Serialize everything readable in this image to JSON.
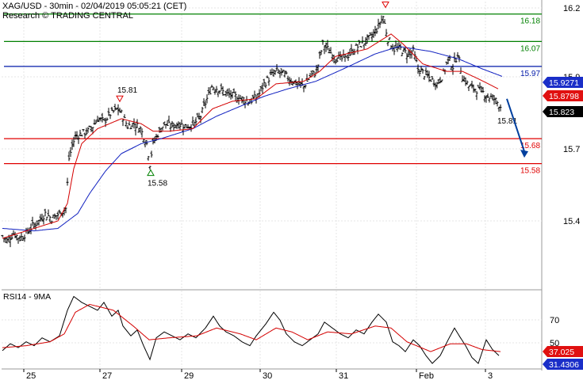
{
  "header": {
    "title_line": "XAG/USD - 30min - 02/04/2019 05:05:21 (CET)",
    "research_line": "Research © TRADING CENTRAL"
  },
  "rsi_panel": {
    "label": "RSI14 - 9MA"
  },
  "colors": {
    "price": "#000000",
    "ma_fast": "#d40000",
    "ma_slow": "#1020c0",
    "resistance": "#008000",
    "pivot": "#0018a8",
    "support": "#e00000",
    "arrow": "#003f9e",
    "badge_blue": "#1a2ec8",
    "badge_red": "#e01010",
    "badge_black": "#000000",
    "grid": "#e4e4e4",
    "axis": "#9a9a9a"
  },
  "chart_data": [
    {
      "type": "line",
      "title": "XAG/USD - 30min",
      "xlabel": "",
      "ylabel": "",
      "x_tick_labels": [
        "25",
        "27",
        "29",
        "30",
        "31",
        "Feb",
        "3"
      ],
      "y_tick_labels": [
        "16.2",
        "15.9",
        "15.7",
        "15.4"
      ],
      "ylim": [
        15.08,
        16.23
      ],
      "grid": true,
      "price_waypoints": [
        {
          "x": 0,
          "y": 15.29
        },
        {
          "x": 6,
          "y": 15.27
        },
        {
          "x": 14,
          "y": 15.3
        },
        {
          "x": 22,
          "y": 15.28
        },
        {
          "x": 30,
          "y": 15.3
        },
        {
          "x": 38,
          "y": 15.33
        },
        {
          "x": 46,
          "y": 15.35
        },
        {
          "x": 54,
          "y": 15.38
        },
        {
          "x": 62,
          "y": 15.36
        },
        {
          "x": 72,
          "y": 15.38
        },
        {
          "x": 80,
          "y": 15.4
        },
        {
          "x": 84,
          "y": 15.6
        },
        {
          "x": 88,
          "y": 15.65
        },
        {
          "x": 92,
          "y": 15.69
        },
        {
          "x": 100,
          "y": 15.7
        },
        {
          "x": 108,
          "y": 15.71
        },
        {
          "x": 114,
          "y": 15.73
        },
        {
          "x": 120,
          "y": 15.76
        },
        {
          "x": 128,
          "y": 15.75
        },
        {
          "x": 136,
          "y": 15.78
        },
        {
          "x": 145,
          "y": 15.8
        },
        {
          "x": 150,
          "y": 15.78
        },
        {
          "x": 158,
          "y": 15.73
        },
        {
          "x": 166,
          "y": 15.74
        },
        {
          "x": 174,
          "y": 15.72
        },
        {
          "x": 182,
          "y": 15.66
        },
        {
          "x": 186,
          "y": 15.58
        },
        {
          "x": 190,
          "y": 15.66
        },
        {
          "x": 196,
          "y": 15.7
        },
        {
          "x": 204,
          "y": 15.74
        },
        {
          "x": 212,
          "y": 15.73
        },
        {
          "x": 222,
          "y": 15.74
        },
        {
          "x": 232,
          "y": 15.73
        },
        {
          "x": 242,
          "y": 15.74
        },
        {
          "x": 250,
          "y": 15.77
        },
        {
          "x": 258,
          "y": 15.84
        },
        {
          "x": 264,
          "y": 15.89
        },
        {
          "x": 272,
          "y": 15.88
        },
        {
          "x": 282,
          "y": 15.86
        },
        {
          "x": 292,
          "y": 15.85
        },
        {
          "x": 302,
          "y": 15.84
        },
        {
          "x": 312,
          "y": 15.83
        },
        {
          "x": 322,
          "y": 15.85
        },
        {
          "x": 330,
          "y": 15.9
        },
        {
          "x": 338,
          "y": 15.93
        },
        {
          "x": 346,
          "y": 15.95
        },
        {
          "x": 354,
          "y": 15.94
        },
        {
          "x": 362,
          "y": 15.92
        },
        {
          "x": 372,
          "y": 15.9
        },
        {
          "x": 380,
          "y": 15.89
        },
        {
          "x": 388,
          "y": 15.93
        },
        {
          "x": 396,
          "y": 15.95
        },
        {
          "x": 404,
          "y": 16.06
        },
        {
          "x": 410,
          "y": 16.04
        },
        {
          "x": 418,
          "y": 16.01
        },
        {
          "x": 428,
          "y": 16.0
        },
        {
          "x": 438,
          "y": 16.02
        },
        {
          "x": 448,
          "y": 16.05
        },
        {
          "x": 458,
          "y": 16.07
        },
        {
          "x": 466,
          "y": 16.09
        },
        {
          "x": 474,
          "y": 16.13
        },
        {
          "x": 480,
          "y": 16.17
        },
        {
          "x": 486,
          "y": 16.08
        },
        {
          "x": 494,
          "y": 16.04
        },
        {
          "x": 502,
          "y": 16.04
        },
        {
          "x": 510,
          "y": 16.02
        },
        {
          "x": 518,
          "y": 16.03
        },
        {
          "x": 524,
          "y": 15.96
        },
        {
          "x": 532,
          "y": 15.94
        },
        {
          "x": 540,
          "y": 15.92
        },
        {
          "x": 548,
          "y": 15.9
        },
        {
          "x": 556,
          "y": 15.94
        },
        {
          "x": 562,
          "y": 16.0
        },
        {
          "x": 568,
          "y": 15.97
        },
        {
          "x": 574,
          "y": 16.02
        },
        {
          "x": 580,
          "y": 15.93
        },
        {
          "x": 588,
          "y": 15.89
        },
        {
          "x": 596,
          "y": 15.88
        },
        {
          "x": 604,
          "y": 15.87
        },
        {
          "x": 612,
          "y": 15.85
        },
        {
          "x": 620,
          "y": 15.84
        },
        {
          "x": 628,
          "y": 15.81
        }
      ],
      "ma_fast_waypoints": [
        {
          "x": 0,
          "y": 15.28
        },
        {
          "x": 40,
          "y": 15.32
        },
        {
          "x": 70,
          "y": 15.35
        },
        {
          "x": 82,
          "y": 15.42
        },
        {
          "x": 90,
          "y": 15.56
        },
        {
          "x": 100,
          "y": 15.66
        },
        {
          "x": 120,
          "y": 15.72
        },
        {
          "x": 150,
          "y": 15.76
        },
        {
          "x": 175,
          "y": 15.74
        },
        {
          "x": 190,
          "y": 15.71
        },
        {
          "x": 210,
          "y": 15.71
        },
        {
          "x": 240,
          "y": 15.72
        },
        {
          "x": 265,
          "y": 15.8
        },
        {
          "x": 290,
          "y": 15.83
        },
        {
          "x": 320,
          "y": 15.84
        },
        {
          "x": 345,
          "y": 15.9
        },
        {
          "x": 380,
          "y": 15.91
        },
        {
          "x": 400,
          "y": 15.95
        },
        {
          "x": 420,
          "y": 16.01
        },
        {
          "x": 460,
          "y": 16.04
        },
        {
          "x": 490,
          "y": 16.1
        },
        {
          "x": 505,
          "y": 16.06
        },
        {
          "x": 530,
          "y": 15.98
        },
        {
          "x": 560,
          "y": 15.95
        },
        {
          "x": 580,
          "y": 15.95
        },
        {
          "x": 600,
          "y": 15.92
        },
        {
          "x": 625,
          "y": 15.88
        }
      ],
      "ma_slow_waypoints": [
        {
          "x": 0,
          "y": 15.32
        },
        {
          "x": 40,
          "y": 15.31
        },
        {
          "x": 70,
          "y": 15.32
        },
        {
          "x": 95,
          "y": 15.38
        },
        {
          "x": 110,
          "y": 15.46
        },
        {
          "x": 130,
          "y": 15.55
        },
        {
          "x": 150,
          "y": 15.62
        },
        {
          "x": 175,
          "y": 15.66
        },
        {
          "x": 200,
          "y": 15.68
        },
        {
          "x": 240,
          "y": 15.72
        },
        {
          "x": 270,
          "y": 15.77
        },
        {
          "x": 300,
          "y": 15.81
        },
        {
          "x": 330,
          "y": 15.85
        },
        {
          "x": 360,
          "y": 15.88
        },
        {
          "x": 395,
          "y": 15.91
        },
        {
          "x": 430,
          "y": 15.96
        },
        {
          "x": 470,
          "y": 16.02
        },
        {
          "x": 500,
          "y": 16.05
        },
        {
          "x": 540,
          "y": 16.03
        },
        {
          "x": 575,
          "y": 16.0
        },
        {
          "x": 605,
          "y": 15.96
        },
        {
          "x": 630,
          "y": 15.93
        }
      ],
      "horizontal_levels": [
        {
          "value": 16.18,
          "label": "16.18",
          "kind": "resistance"
        },
        {
          "value": 16.07,
          "label": "16.07",
          "kind": "resistance"
        },
        {
          "value": 15.97,
          "label": "15.97",
          "kind": "pivot"
        },
        {
          "value": 15.68,
          "label": "15.68",
          "kind": "support"
        },
        {
          "value": 15.58,
          "label": "15.58",
          "kind": "support"
        }
      ],
      "annotations": [
        {
          "text": "15.81",
          "at_x": 148,
          "at_y": 15.81,
          "marker": "down-triangle",
          "placement": "above"
        },
        {
          "text": "15.58",
          "at_x": 187,
          "at_y": 15.58,
          "marker": "up-triangle",
          "placement": "below"
        },
        {
          "text": "",
          "at_x": 483,
          "at_y": 16.2,
          "marker": "down-triangle",
          "placement": "above"
        },
        {
          "text": "15.81",
          "at_x": 628,
          "at_y": 15.81,
          "marker": "none",
          "placement": "below"
        }
      ],
      "arrow": {
        "from": {
          "x": 636,
          "y": 15.84
        },
        "to": {
          "x": 658,
          "y": 15.61
        }
      },
      "price_badges": [
        {
          "text": "15.9271",
          "value": 15.9271,
          "color": "badge_blue"
        },
        {
          "text": "15.8798",
          "value": 15.8798,
          "color": "badge_red"
        },
        {
          "text": "15.823",
          "value": 15.823,
          "color": "badge_black"
        }
      ]
    },
    {
      "type": "line",
      "title": "RSI14 - 9MA",
      "xlabel": "",
      "ylabel": "",
      "y_tick_labels": [
        "70",
        "50"
      ],
      "ylim": [
        18,
        96
      ],
      "grid": true,
      "rsi_waypoints": [
        {
          "x": 0,
          "y": 35
        },
        {
          "x": 10,
          "y": 42
        },
        {
          "x": 20,
          "y": 38
        },
        {
          "x": 30,
          "y": 44
        },
        {
          "x": 40,
          "y": 40
        },
        {
          "x": 50,
          "y": 48
        },
        {
          "x": 60,
          "y": 44
        },
        {
          "x": 72,
          "y": 50
        },
        {
          "x": 82,
          "y": 76
        },
        {
          "x": 90,
          "y": 90
        },
        {
          "x": 100,
          "y": 84
        },
        {
          "x": 110,
          "y": 80
        },
        {
          "x": 120,
          "y": 76
        },
        {
          "x": 128,
          "y": 84
        },
        {
          "x": 138,
          "y": 70
        },
        {
          "x": 146,
          "y": 76
        },
        {
          "x": 152,
          "y": 60
        },
        {
          "x": 162,
          "y": 50
        },
        {
          "x": 170,
          "y": 56
        },
        {
          "x": 178,
          "y": 40
        },
        {
          "x": 186,
          "y": 26
        },
        {
          "x": 194,
          "y": 48
        },
        {
          "x": 204,
          "y": 54
        },
        {
          "x": 214,
          "y": 50
        },
        {
          "x": 224,
          "y": 46
        },
        {
          "x": 234,
          "y": 52
        },
        {
          "x": 244,
          "y": 48
        },
        {
          "x": 256,
          "y": 58
        },
        {
          "x": 266,
          "y": 70
        },
        {
          "x": 274,
          "y": 60
        },
        {
          "x": 282,
          "y": 54
        },
        {
          "x": 292,
          "y": 50
        },
        {
          "x": 302,
          "y": 44
        },
        {
          "x": 312,
          "y": 40
        },
        {
          "x": 320,
          "y": 50
        },
        {
          "x": 332,
          "y": 62
        },
        {
          "x": 342,
          "y": 74
        },
        {
          "x": 350,
          "y": 66
        },
        {
          "x": 358,
          "y": 52
        },
        {
          "x": 368,
          "y": 44
        },
        {
          "x": 378,
          "y": 40
        },
        {
          "x": 388,
          "y": 46
        },
        {
          "x": 398,
          "y": 52
        },
        {
          "x": 406,
          "y": 64
        },
        {
          "x": 416,
          "y": 58
        },
        {
          "x": 426,
          "y": 52
        },
        {
          "x": 436,
          "y": 48
        },
        {
          "x": 446,
          "y": 56
        },
        {
          "x": 456,
          "y": 52
        },
        {
          "x": 466,
          "y": 64
        },
        {
          "x": 474,
          "y": 72
        },
        {
          "x": 484,
          "y": 64
        },
        {
          "x": 492,
          "y": 44
        },
        {
          "x": 500,
          "y": 40
        },
        {
          "x": 508,
          "y": 34
        },
        {
          "x": 518,
          "y": 46
        },
        {
          "x": 526,
          "y": 40
        },
        {
          "x": 534,
          "y": 30
        },
        {
          "x": 542,
          "y": 22
        },
        {
          "x": 552,
          "y": 30
        },
        {
          "x": 562,
          "y": 46
        },
        {
          "x": 570,
          "y": 58
        },
        {
          "x": 576,
          "y": 50
        },
        {
          "x": 584,
          "y": 40
        },
        {
          "x": 592,
          "y": 28
        },
        {
          "x": 600,
          "y": 22
        },
        {
          "x": 610,
          "y": 46
        },
        {
          "x": 618,
          "y": 36
        },
        {
          "x": 626,
          "y": 30
        }
      ],
      "rsi_ma_waypoints": [
        {
          "x": 0,
          "y": 38
        },
        {
          "x": 30,
          "y": 40
        },
        {
          "x": 60,
          "y": 44
        },
        {
          "x": 78,
          "y": 52
        },
        {
          "x": 92,
          "y": 74
        },
        {
          "x": 110,
          "y": 82
        },
        {
          "x": 140,
          "y": 76
        },
        {
          "x": 165,
          "y": 60
        },
        {
          "x": 185,
          "y": 46
        },
        {
          "x": 210,
          "y": 48
        },
        {
          "x": 245,
          "y": 50
        },
        {
          "x": 270,
          "y": 58
        },
        {
          "x": 300,
          "y": 52
        },
        {
          "x": 320,
          "y": 46
        },
        {
          "x": 345,
          "y": 58
        },
        {
          "x": 365,
          "y": 54
        },
        {
          "x": 385,
          "y": 46
        },
        {
          "x": 410,
          "y": 54
        },
        {
          "x": 440,
          "y": 52
        },
        {
          "x": 470,
          "y": 60
        },
        {
          "x": 490,
          "y": 58
        },
        {
          "x": 510,
          "y": 44
        },
        {
          "x": 540,
          "y": 34
        },
        {
          "x": 565,
          "y": 42
        },
        {
          "x": 585,
          "y": 42
        },
        {
          "x": 605,
          "y": 36
        },
        {
          "x": 628,
          "y": 34
        }
      ],
      "badges": [
        {
          "text": "37.025",
          "value": 37.025,
          "color": "badge_red"
        },
        {
          "text": "31.4306",
          "value": 31.4306,
          "color": "badge_blue"
        }
      ]
    }
  ]
}
